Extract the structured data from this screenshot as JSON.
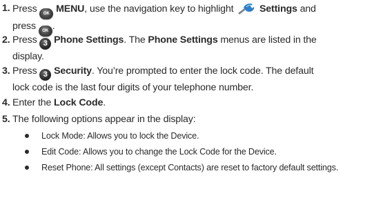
{
  "steps": [
    {
      "number": "1.",
      "press": "Press",
      "menu_key_label": "OK",
      "menu": "MENU",
      "text_a": ", use the navigation key to highlight",
      "settings": "Settings",
      "and": "and",
      "press2": "press",
      "ok_key_label": "OK",
      "period": "."
    },
    {
      "number": "2.",
      "press": "Press",
      "key_label": "3",
      "item": "Phone Settings",
      "text_a": ". The",
      "item2": "Phone Settings",
      "text_b": "menus are listed in the",
      "text_c": "display."
    },
    {
      "number": "3.",
      "press": "Press",
      "key_label": "3",
      "item": "Security",
      "text_a": ". You’re prompted to enter the lock code. The default",
      "text_b": "lock code is the last four digits of your telephone number."
    },
    {
      "number": "4.",
      "text_a": "Enter the",
      "item": "Lock Code",
      "period": "."
    },
    {
      "number": "5.",
      "text_a": "The following options appear in the display:"
    }
  ],
  "options": [
    "Lock Mode: Allows you to lock the Device.",
    "Edit Code: Allows you to change the Lock Code for the Device.",
    "Reset Phone: All settings (except Contacts) are reset to factory default settings."
  ],
  "icons": {
    "menu_key": "ok-key-icon",
    "settings": "settings-wrench-icon",
    "number_key": "number-3-key-icon"
  },
  "colors": {
    "text": "#2a2a2a",
    "key": "#3a3a3a",
    "settings_icon": "#2c7fc9"
  }
}
